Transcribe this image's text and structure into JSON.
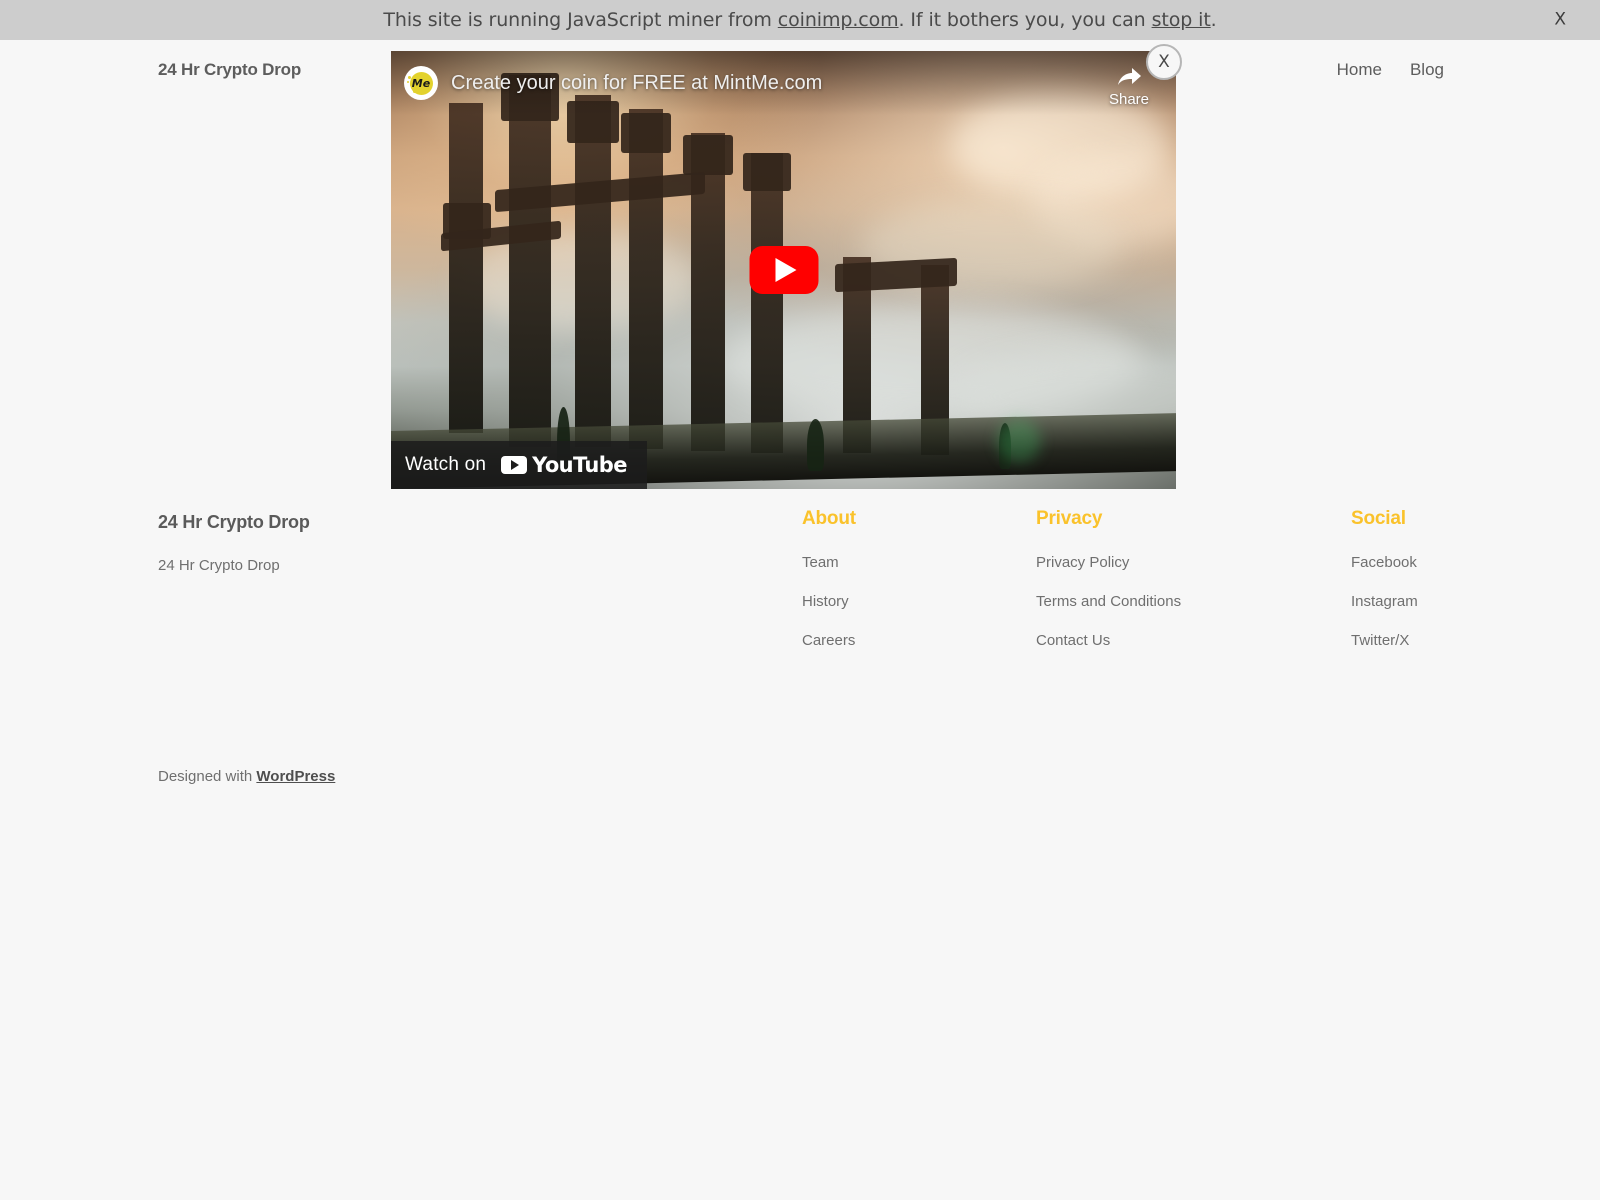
{
  "banner": {
    "text_before": "This site is running JavaScript miner from ",
    "link1": "coinimp.com",
    "text_middle": ". If it bothers you, you can ",
    "link2": "stop it",
    "text_after": ".",
    "close_label": "X",
    "background_color": "#cdcdcd"
  },
  "header": {
    "site_title": "24 Hr Crypto Drop",
    "nav": [
      {
        "label": "Home"
      },
      {
        "label": "Blog"
      }
    ]
  },
  "video_overlay": {
    "ad_logo_text": "Me",
    "ad_text": "Create your coin for FREE at MintMe.com",
    "share_label": "Share",
    "share_icon": "share-arrow-icon",
    "play_icon": "play-button-icon",
    "watch_on_label": "Watch on",
    "youtube_wordmark": "YouTube",
    "close_label": "X",
    "accent_color": "#ff0000"
  },
  "footer": {
    "brand": {
      "title": "24 Hr Crypto Drop",
      "description": "24 Hr Crypto Drop"
    },
    "heading_color": "#fac22b",
    "columns": [
      {
        "heading": "About",
        "links": [
          {
            "label": "Team"
          },
          {
            "label": "History"
          },
          {
            "label": "Careers"
          }
        ]
      },
      {
        "heading": "Privacy",
        "links": [
          {
            "label": "Privacy Policy"
          },
          {
            "label": "Terms and Conditions"
          },
          {
            "label": "Contact Us"
          }
        ]
      },
      {
        "heading": "Social",
        "links": [
          {
            "label": "Facebook"
          },
          {
            "label": "Instagram"
          },
          {
            "label": "Twitter/X"
          }
        ]
      }
    ],
    "credit_prefix": "Designed with ",
    "credit_link": "WordPress"
  }
}
